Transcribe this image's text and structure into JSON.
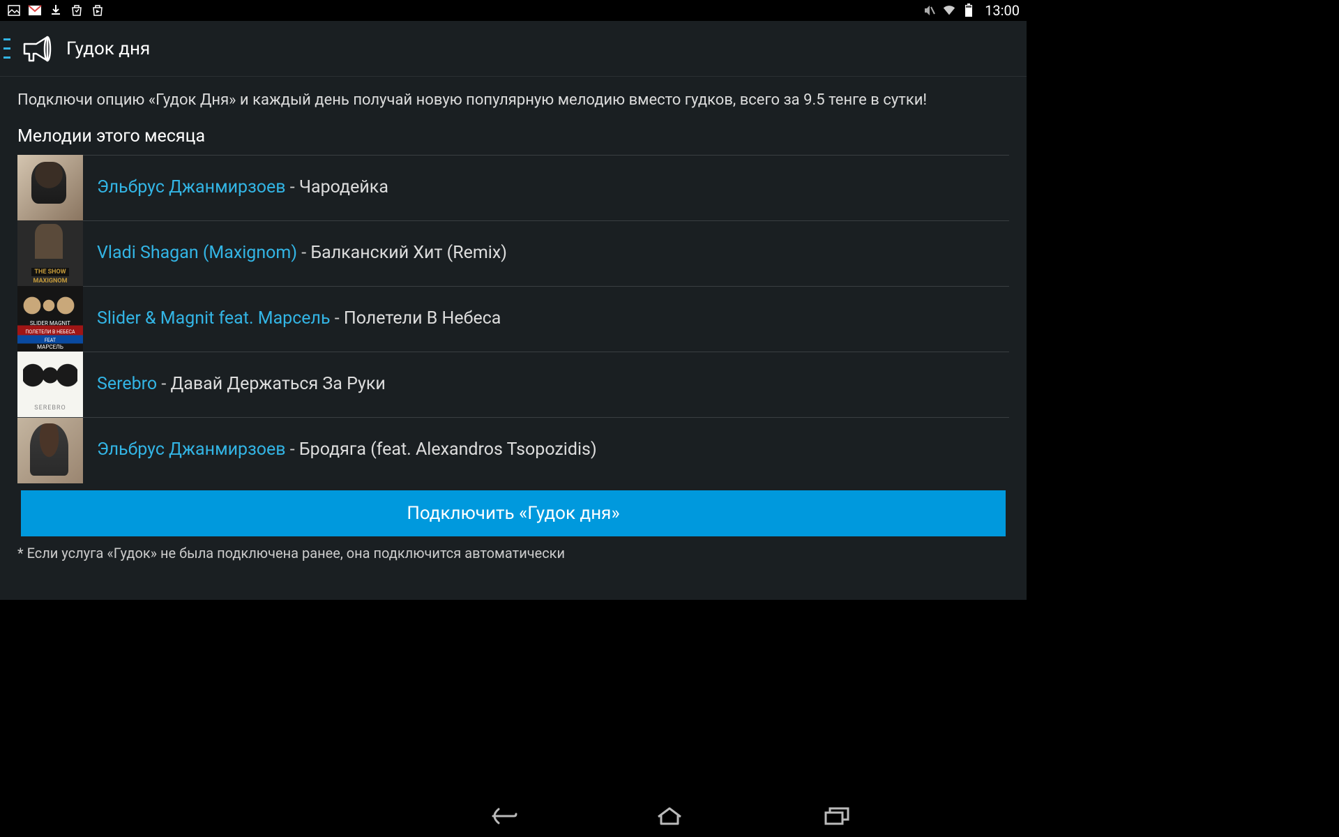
{
  "statusBar": {
    "time": "13:00"
  },
  "header": {
    "title": "Гудок дня"
  },
  "content": {
    "description": "Подключи опцию «Гудок Дня» и каждый день получай новую популярную мелодию вместо гудков, всего за 9.5 тенге в сутки!",
    "sectionTitle": "Мелодии этого месяца",
    "tracks": [
      {
        "artist": "Эльбрус Джанмирзоев",
        "title": "Чародейка"
      },
      {
        "artist": "Vladi Shagan (Maxignom)",
        "title": "Балканский Хит (Remix)"
      },
      {
        "artist": "Slider & Magnit feat. Марсель",
        "title": "Полетели В Небеса"
      },
      {
        "artist": "Serebro",
        "title": "Давай Держаться За Руки"
      },
      {
        "artist": "Эльбрус Джанмирзоев",
        "title": "Бродяга (feat. Alexandros Tsopozidis)"
      }
    ],
    "ctaLabel": "Подключить «Гудок дня»",
    "footnote": "* Если услуга «Гудок» не была подключена ранее, она подключится автоматически",
    "thumb2": {
      "label1": "THE SHOW",
      "label2": "MAXIGNOM"
    },
    "thumb3": {
      "l1": "SLIDER   MAGNIT",
      "l2": "ПОЛЕТЕЛИ В НЕБЕСА",
      "l3": "FEAT",
      "l4": "МАРСЕЛЬ"
    }
  }
}
